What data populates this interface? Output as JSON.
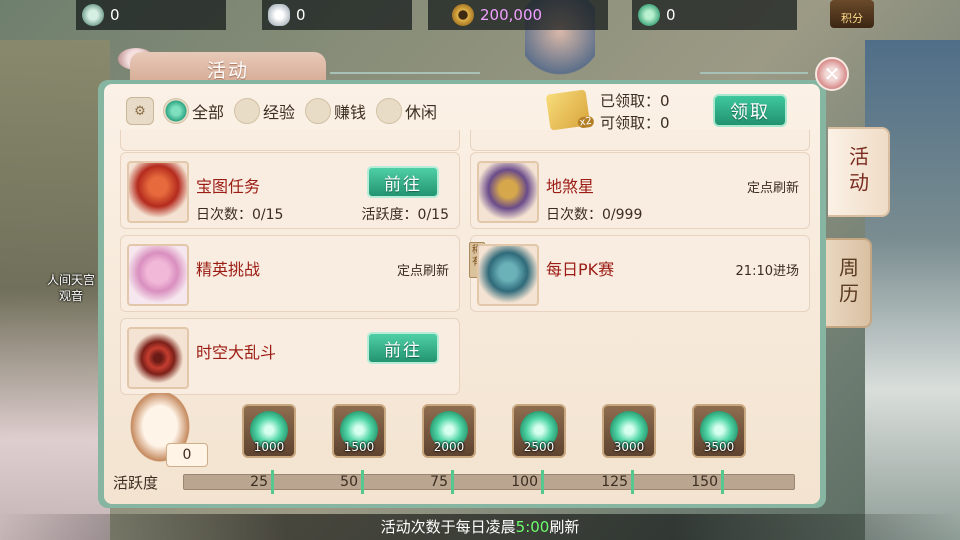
{
  "resources": [
    {
      "icon": "jade-icon",
      "value": "0"
    },
    {
      "icon": "silver-ingot-icon",
      "value": "0"
    },
    {
      "icon": "copper-coin-icon",
      "value": "200,000"
    },
    {
      "icon": "green-cloud-icon",
      "value": "0"
    }
  ],
  "points_button": {
    "label": "积分"
  },
  "background_label": "人间天宫\n观音",
  "window": {
    "title": "活动"
  },
  "filters": [
    {
      "label": "全部",
      "selected": true
    },
    {
      "label": "经验",
      "selected": false
    },
    {
      "label": "赚钱",
      "selected": false
    },
    {
      "label": "休闲",
      "selected": false
    }
  ],
  "claim": {
    "badge": "x2",
    "claimed_label": "已领取：0",
    "claimable_label": "可领取：0",
    "button": "领取"
  },
  "activities": [
    {
      "name": "宝图任务",
      "daily": "日次数：0/15",
      "activity": "活跃度：0/15",
      "button": "前往"
    },
    {
      "name": "地煞星",
      "daily": "日次数：0/999",
      "note": "定点刷新"
    },
    {
      "name": "精英挑战",
      "note": "定点刷新"
    },
    {
      "name": "每日PK赛",
      "note": "21:10进场",
      "tag": "稀有"
    },
    {
      "name": "时空大乱斗",
      "button": "前往"
    }
  ],
  "side_tabs": [
    {
      "label": "活动",
      "active": true
    },
    {
      "label": "周历",
      "active": false
    }
  ],
  "mascot_count": "0",
  "rewards": [
    "1000",
    "1500",
    "2000",
    "2500",
    "3000",
    "3500"
  ],
  "activity_bar": {
    "label": "活跃度",
    "current": 0,
    "max": 150,
    "milestones": [
      "25",
      "50",
      "75",
      "100",
      "125",
      "150"
    ]
  },
  "footer": {
    "prefix": "活动次数于每日凌晨",
    "time": "5:00",
    "suffix": "刷新"
  },
  "colors": {
    "accent_green": "#2fa582",
    "title_red": "#9b1c14",
    "gold": "#e8c36b"
  }
}
